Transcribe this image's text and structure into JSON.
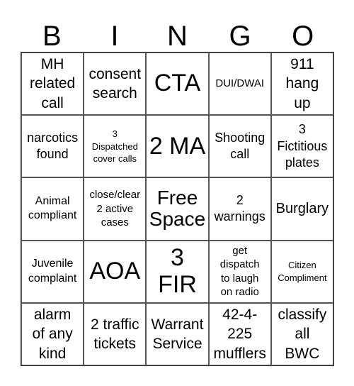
{
  "header": {
    "letters": [
      "B",
      "I",
      "N",
      "G",
      "O"
    ]
  },
  "cells": [
    "MH related call",
    "consent search",
    "CTA",
    "DUI/DWAI",
    "911 hang up",
    "narcotics found",
    "3 Dispatched cover calls",
    "2 MA",
    "Shooting call",
    "3 Fictitious plates",
    "Animal compliant",
    "close/clear 2 active cases",
    "Free Space",
    "2 warnings",
    "Burglary",
    "Juvenile complaint",
    "AOA",
    "3 FIR",
    "get dispatch to laugh on radio",
    "Citizen Compliment",
    "alarm of any kind",
    "2 traffic tickets",
    "Warrant Service",
    "42-4-225 mufflers",
    "classify all BWC"
  ]
}
